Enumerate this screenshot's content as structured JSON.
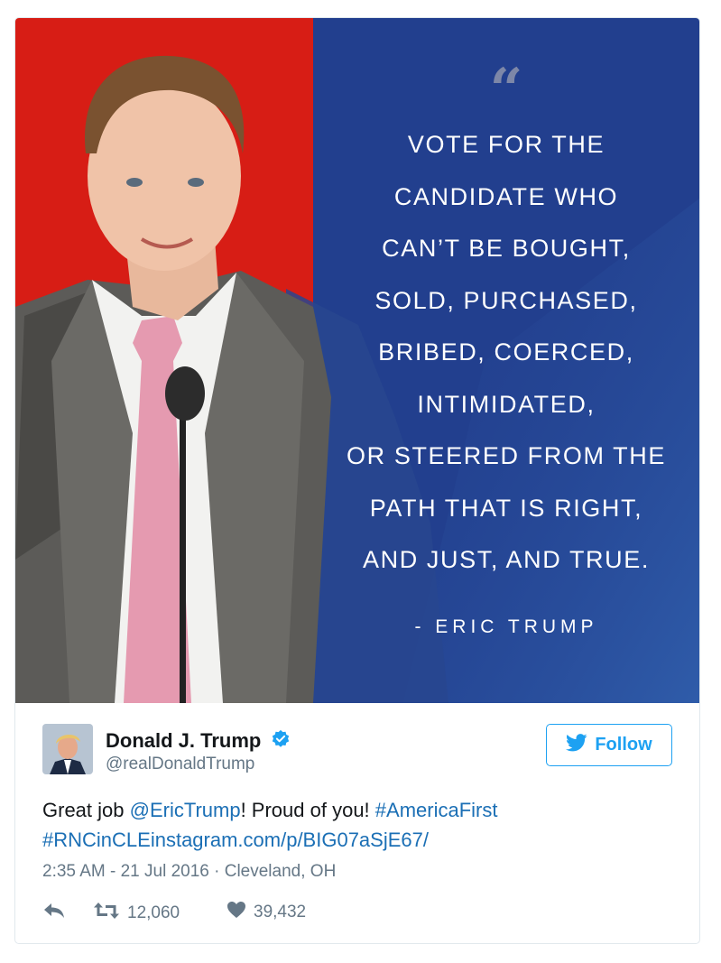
{
  "quote": {
    "mark": "“",
    "lines": [
      "VOTE FOR THE",
      "CANDIDATE WHO",
      "CAN’T BE BOUGHT,",
      "SOLD, PURCHASED,",
      "BRIBED, COERCED,",
      "INTIMIDATED,",
      "OR STEERED FROM THE",
      "PATH THAT IS RIGHT,",
      "AND JUST, AND TRUE."
    ],
    "attribution": "- ERIC TRUMP"
  },
  "author": {
    "display_name": "Donald J. Trump",
    "screen_name": "@realDonaldTrump",
    "verified": true
  },
  "follow": {
    "label": "Follow"
  },
  "tweet": {
    "text_1": "Great job ",
    "mention": "@EricTrump",
    "text_2": "! Proud of you! ",
    "hashtag_1": "#AmericaFirst",
    "hashtag_2": "#RNCinCLE",
    "link": "instagram.com/p/BIG07aSjE67/",
    "timestamp": "2:35 AM - 21 Jul 2016",
    "separator": " · ",
    "location": "Cleveland, OH"
  },
  "actions": {
    "retweet_count": "12,060",
    "like_count": "39,432"
  },
  "colors": {
    "left_panel_red": "#d71d15",
    "right_panel_blue": "#223f8e",
    "link_blue": "#1b6fb5",
    "twitter_blue": "#1da1f2",
    "muted_gray": "#657786"
  },
  "icons": {
    "verified": "verified-badge-icon",
    "follow": "twitter-bird-icon",
    "reply": "reply-icon",
    "retweet": "retweet-icon",
    "like": "heart-icon"
  }
}
